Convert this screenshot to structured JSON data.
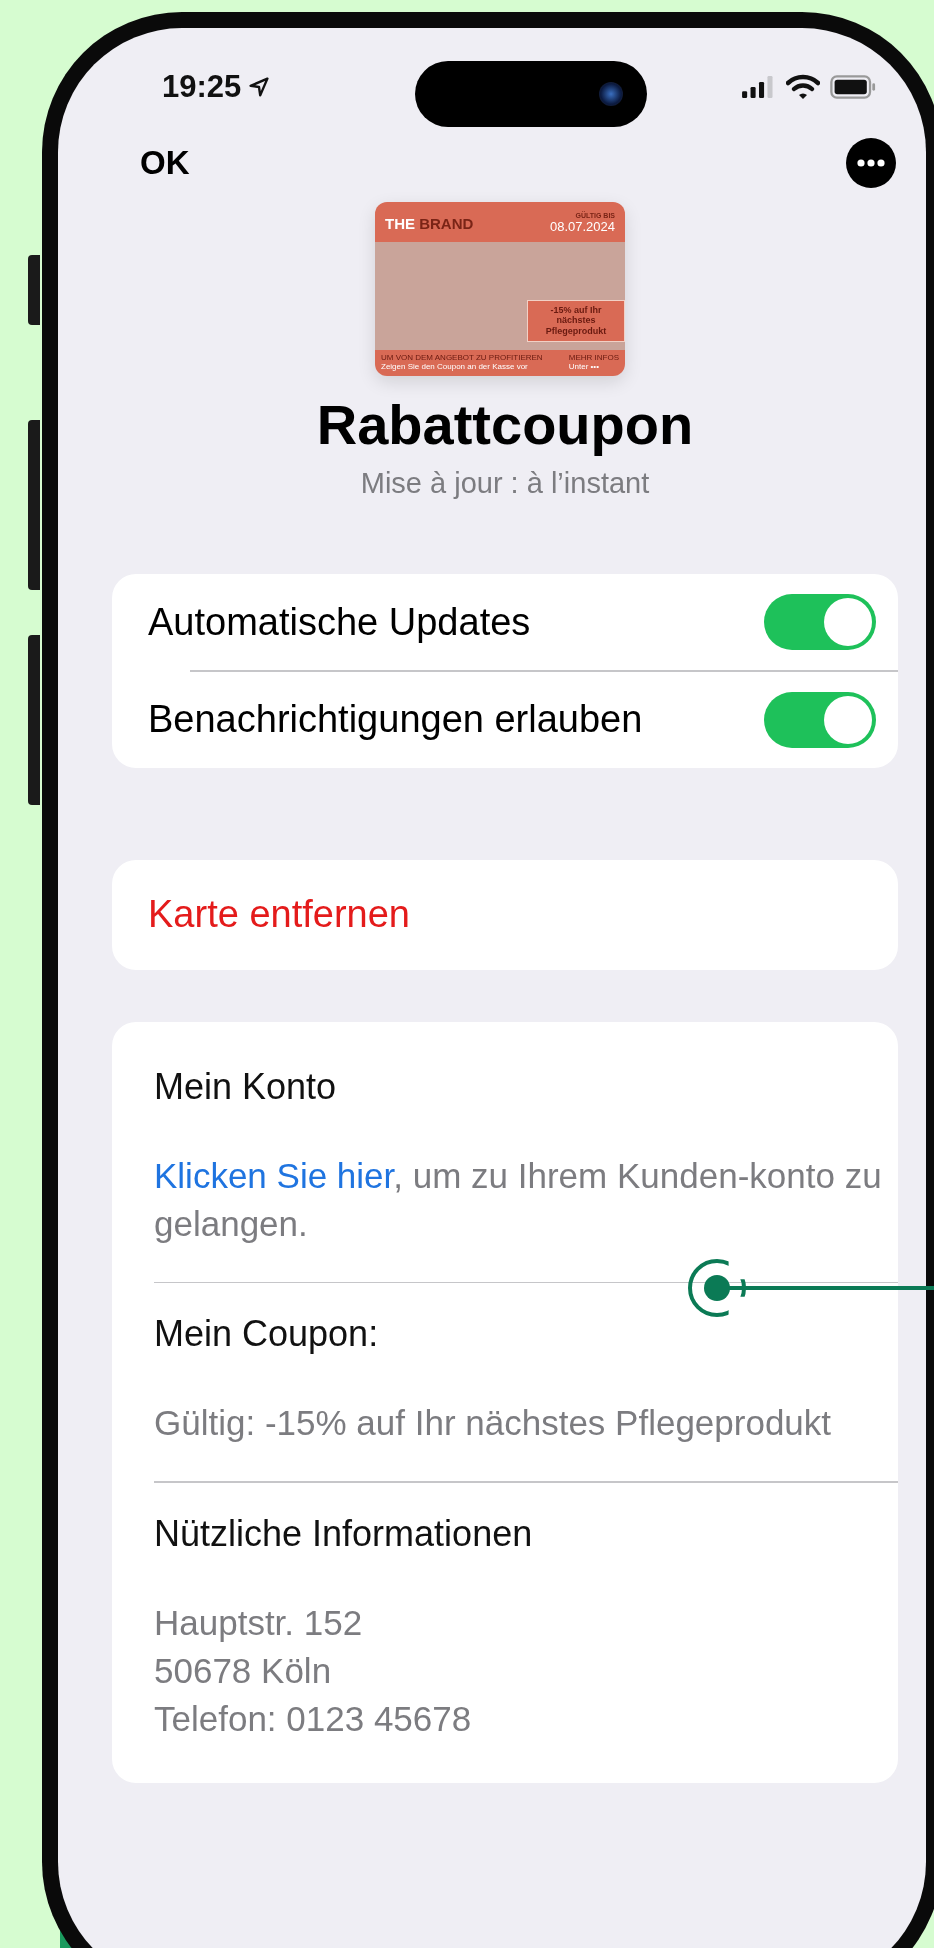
{
  "status_bar": {
    "time": "19:25"
  },
  "nav": {
    "done": "OK"
  },
  "pass": {
    "brand_first": "THE",
    "brand_second": "BRAND",
    "valid_label": "GÜLTIG BIS",
    "valid_date": "08.07.2024",
    "offer": "-15% auf Ihr nächstes Pflegeprodukt",
    "footer_left_title": "UM VON DEM ANGEBOT ZU PROFITIEREN",
    "footer_left_text": "Zeigen Sie den Coupon an der Kasse vor",
    "footer_right_title": "MEHR INFOS",
    "footer_right_text": "Unter •••"
  },
  "title": "Rabattcoupon",
  "subtitle": "Mise à jour : à l’instant",
  "settings": [
    {
      "label": "Automatische Updates",
      "on": true
    },
    {
      "label": "Benachrichtigungen erlauben",
      "on": true
    }
  ],
  "remove": "Karte entfernen",
  "back_fields": [
    {
      "label": "Mein Konto",
      "link": "Klicken Sie hier",
      "value": ", um zu Ihrem Kunden-konto zu gelangen."
    },
    {
      "label": "Mein Coupon:",
      "value": "Gültig: -15% auf Ihr nächstes Pflegeprodukt"
    },
    {
      "label": "Nützliche Informationen",
      "lines": [
        "Hauptstr. 152",
        "50678 Köln",
        "Telefon: 0123 45678"
      ]
    }
  ]
}
